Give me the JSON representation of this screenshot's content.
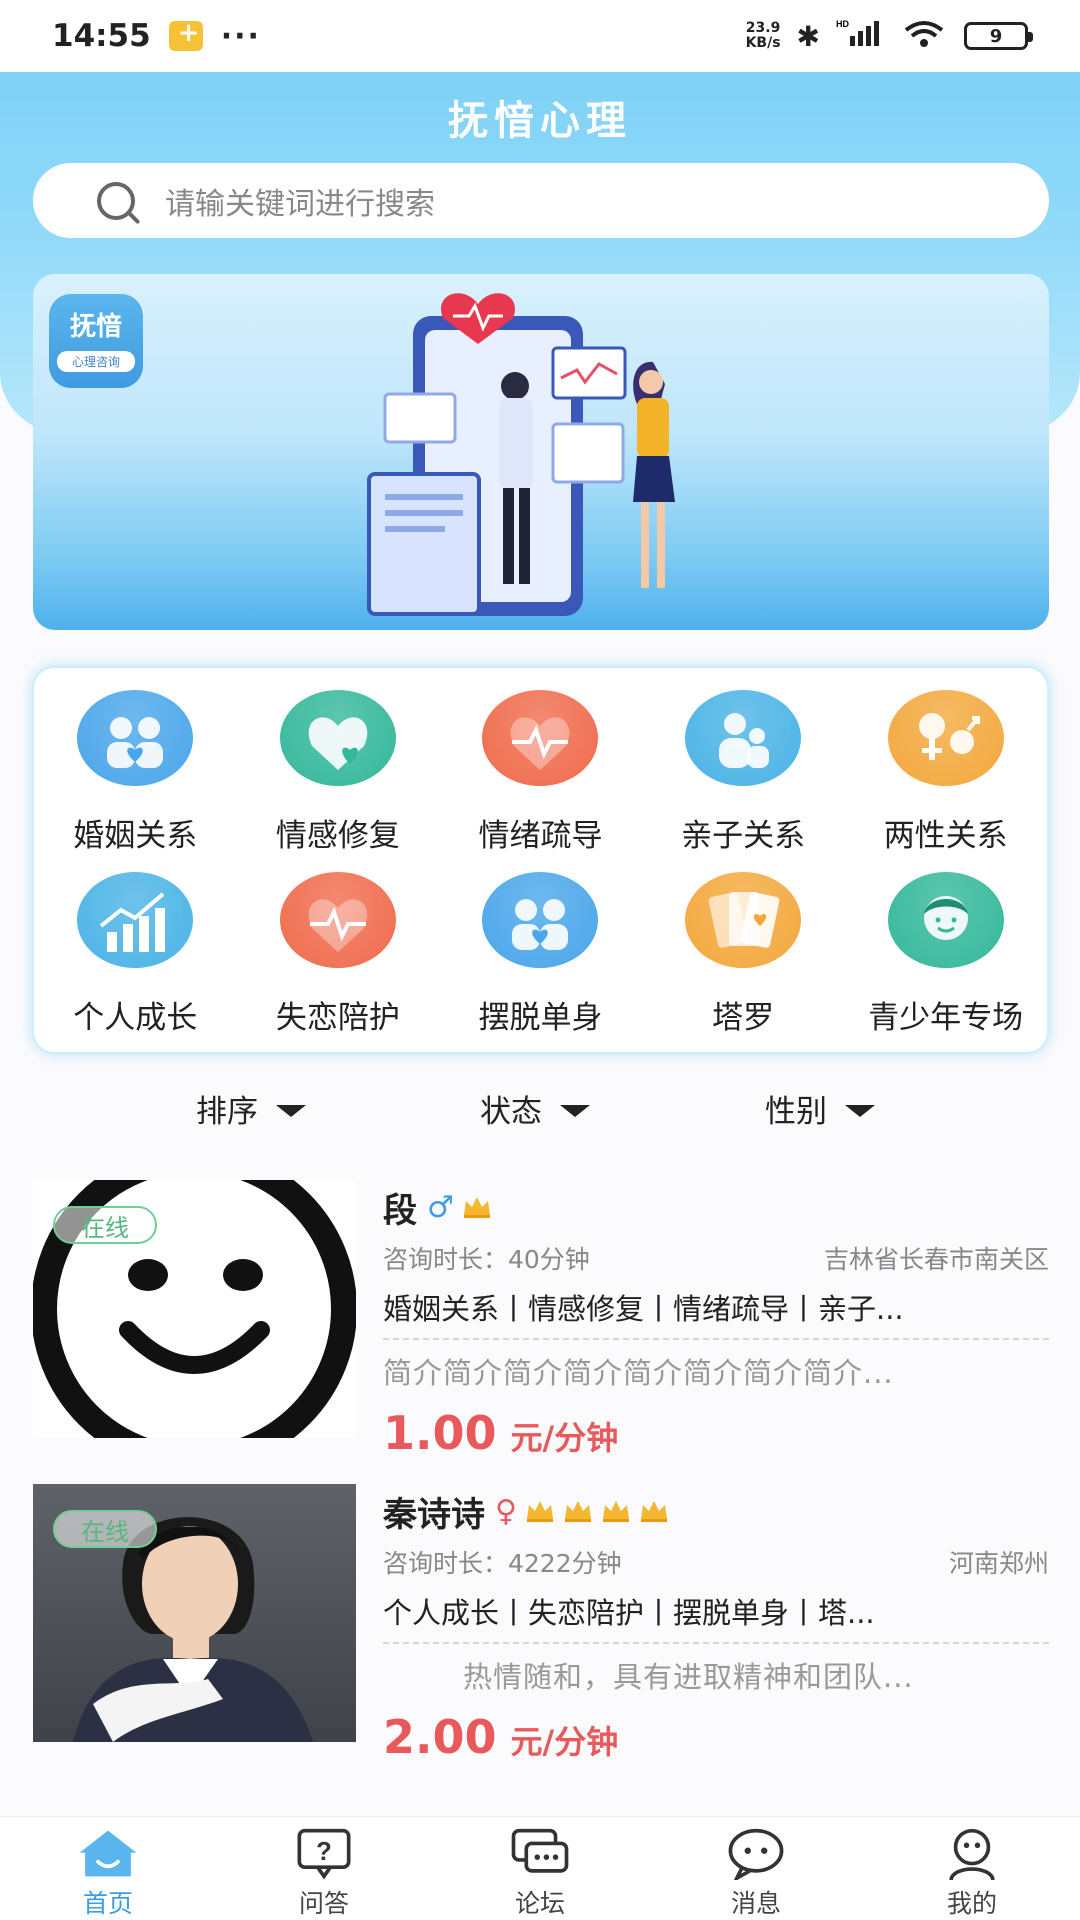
{
  "status_bar": {
    "time": "14:55",
    "dots": "···",
    "net_speed_top": "23.9",
    "net_speed_bottom": "KB/s",
    "battery": "9"
  },
  "header": {
    "title": "抚愔心理"
  },
  "search": {
    "placeholder": "请输关键词进行搜索"
  },
  "banner": {
    "logo_text": "抚愔",
    "logo_subtext": "心理咨询"
  },
  "categories": [
    {
      "label": "婚姻关系",
      "color": "#4aa6ea",
      "icon": "couple-icon"
    },
    {
      "label": "情感修复",
      "color": "#33b89a",
      "icon": "heart-icon"
    },
    {
      "label": "情绪疏导",
      "color": "#f06b4c",
      "icon": "heartbeat-icon"
    },
    {
      "label": "亲子关系",
      "color": "#4ab3e6",
      "icon": "parent-child-icon"
    },
    {
      "label": "两性关系",
      "color": "#f3a83c",
      "icon": "gender-icon"
    },
    {
      "label": "个人成长",
      "color": "#4ab3e6",
      "icon": "growth-chart-icon"
    },
    {
      "label": "失恋陪护",
      "color": "#f06b4c",
      "icon": "broken-heart-icon"
    },
    {
      "label": "摆脱单身",
      "color": "#4aa6ea",
      "icon": "couple-icon"
    },
    {
      "label": "塔罗",
      "color": "#f3a83c",
      "icon": "tarot-cards-icon"
    },
    {
      "label": "青少年专场",
      "color": "#33b89a",
      "icon": "teen-face-icon"
    }
  ],
  "filters": {
    "sort": "排序",
    "status": "状态",
    "gender": "性别"
  },
  "counselors": [
    {
      "badge": "在线",
      "name": "段",
      "gender_symbol": "♂",
      "crowns": 1,
      "duration": "咨询时长：40分钟",
      "location": "吉林省长春市南关区",
      "tags": "婚姻关系丨情感修复丨情绪疏导丨亲子...",
      "intro": "简介简介简介简介简介简介简介简介...",
      "price": "1.00",
      "unit": "元/分钟"
    },
    {
      "badge": "在线",
      "name": "秦诗诗",
      "gender_symbol": "♀",
      "crowns": 4,
      "duration": "咨询时长：4222分钟",
      "location": "河南郑州",
      "tags": "个人成长丨失恋陪护丨摆脱单身丨塔...",
      "intro": "热情随和，具有进取精神和团队...",
      "price": "2.00",
      "unit": "元/分钟"
    }
  ],
  "bottom_nav": [
    {
      "label": "首页",
      "icon": "home-icon",
      "active": true
    },
    {
      "label": "问答",
      "icon": "question-icon",
      "active": false
    },
    {
      "label": "论坛",
      "icon": "forum-icon",
      "active": false
    },
    {
      "label": "消息",
      "icon": "message-icon",
      "active": false
    },
    {
      "label": "我的",
      "icon": "profile-icon",
      "active": false
    }
  ],
  "colors": {
    "accent": "#3b9de3",
    "price": "#e8595c",
    "online": "#56b77f",
    "header_gradient_top": "#7fd1f6"
  }
}
